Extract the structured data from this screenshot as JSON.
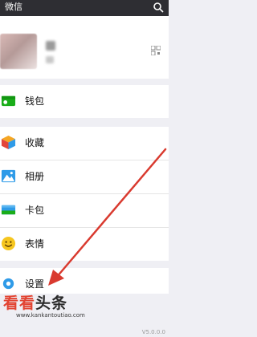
{
  "topbar": {
    "title": "微信",
    "search_icon": "search-icon"
  },
  "profile": {
    "name": "微",
    "wechat_id": "微"
  },
  "groups": [
    {
      "items": [
        {
          "icon": "wallet-icon",
          "label": "钱包",
          "color": "#1aad19"
        }
      ]
    },
    {
      "items": [
        {
          "icon": "favorites-icon",
          "label": "收藏",
          "color": "#f5a623"
        },
        {
          "icon": "album-icon",
          "label": "相册",
          "color": "#2f9be8"
        },
        {
          "icon": "cards-icon",
          "label": "卡包",
          "color": "#2f9be8"
        },
        {
          "icon": "emoji-icon",
          "label": "表情",
          "color": "#f6c61f"
        }
      ]
    },
    {
      "items": [
        {
          "icon": "settings-icon",
          "label": "设置",
          "color": "#2f9be8"
        }
      ]
    }
  ],
  "watermark": {
    "brand_red": "看看",
    "brand_dark": "头条",
    "url": "www.kankantoutiao.com",
    "version": "V5.0.0.0"
  },
  "colors": {
    "accent": "#1aad19",
    "arrow": "#d93a2f",
    "bar": "#2e2e33"
  }
}
